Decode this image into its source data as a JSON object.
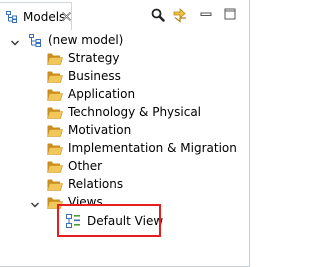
{
  "view_tab": {
    "title": "Models",
    "icon": "model-tree-icon",
    "close_icon": "close-icon"
  },
  "toolbar": {
    "search_icon": "search-icon",
    "link_icon": "link-with-editor-icon",
    "minimize_icon": "minimize-icon",
    "maximize_icon": "maximize-icon"
  },
  "tree": {
    "model": {
      "label": "(new model)",
      "expanded": true
    },
    "folders": [
      {
        "label": "Strategy"
      },
      {
        "label": "Business"
      },
      {
        "label": "Application"
      },
      {
        "label": "Technology & Physical"
      },
      {
        "label": "Motivation"
      },
      {
        "label": "Implementation & Migration"
      },
      {
        "label": "Other"
      },
      {
        "label": "Relations"
      },
      {
        "label": "Views",
        "expanded": true
      }
    ],
    "views": [
      {
        "label": "Default View",
        "highlighted": true
      }
    ]
  },
  "colors": {
    "folder": "#e8b84a",
    "folder_dark": "#c98e1e",
    "highlight_border": "#e61e1e",
    "icon_blue": "#3b6fb6",
    "icon_green": "#4a9a3a"
  }
}
